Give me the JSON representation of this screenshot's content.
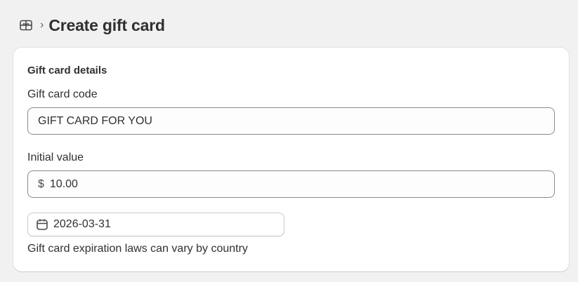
{
  "header": {
    "icon": "gift-card-icon",
    "separator": "›",
    "title": "Create gift card"
  },
  "card": {
    "title": "Gift card details",
    "code": {
      "label": "Gift card code",
      "value": "GIFT CARD FOR YOU"
    },
    "initial_value": {
      "label": "Initial value",
      "prefix": "$",
      "value": "10.00"
    },
    "expiration": {
      "date": "2026-03-31",
      "icon": "calendar-icon",
      "help": "Gift card expiration laws can vary by country"
    }
  },
  "colors": {
    "background": "#f1f1f1",
    "card": "#ffffff",
    "text": "#303030",
    "border": "#8a8a8a"
  }
}
